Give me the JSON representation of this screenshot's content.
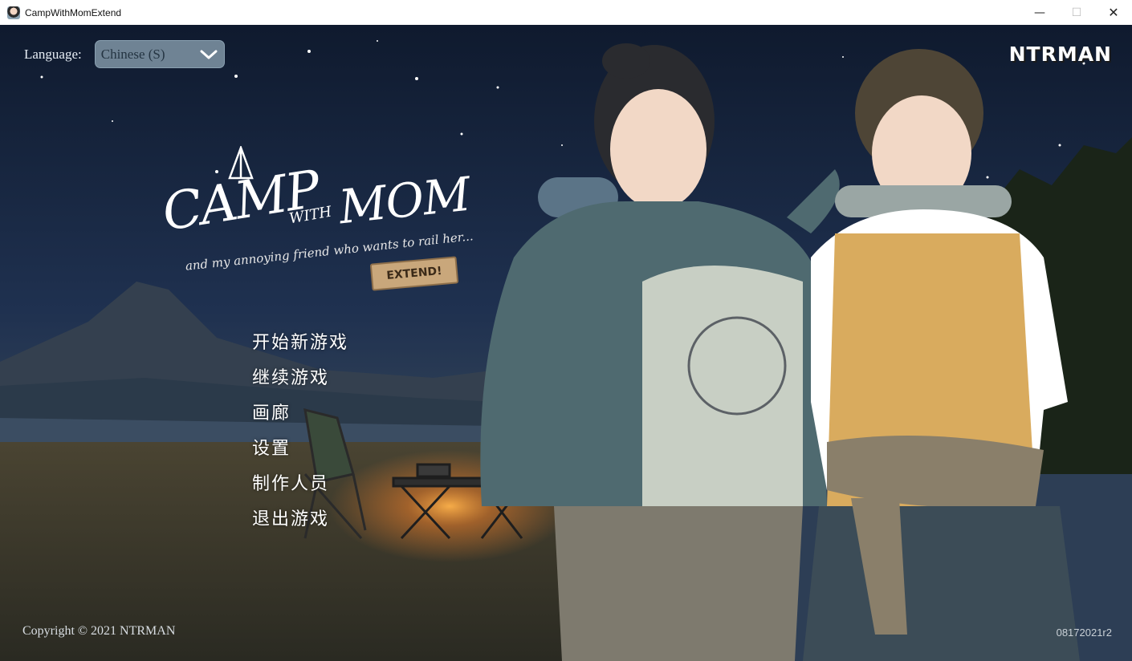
{
  "window": {
    "title": "CampWithMomExtend",
    "icon": "app-avatar-icon",
    "controls": {
      "minimize": "—",
      "maximize": "☐",
      "close": "✕"
    }
  },
  "header": {
    "language_label": "Language:",
    "language_value": "Chinese (S)",
    "brand": "NTRMAN"
  },
  "logo": {
    "title_part1": "CAMP",
    "title_part2": "WITH",
    "title_part3": "MOM",
    "subtitle": "and my annoying friend who wants to rail her...",
    "badge": "EXTEND!"
  },
  "menu": {
    "items": [
      {
        "label": "开始新游戏"
      },
      {
        "label": "继续游戏"
      },
      {
        "label": "画廊"
      },
      {
        "label": "设置"
      },
      {
        "label": "制作人员"
      },
      {
        "label": "退出游戏"
      }
    ]
  },
  "footer": {
    "copyright": "Copyright © 2021 NTRMAN",
    "version": "08172021r2"
  },
  "colors": {
    "sky": "#1b2a45",
    "ground": "#3e3a2a",
    "fire": "#f08a2c",
    "select_bg": "#6f8394"
  }
}
